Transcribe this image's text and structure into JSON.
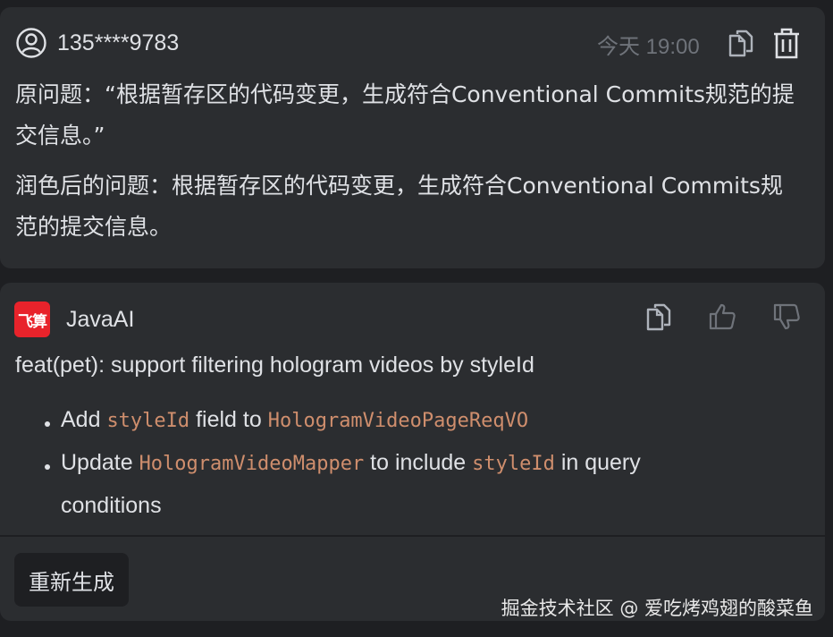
{
  "user_message": {
    "user": "135****9783",
    "timestamp": "今天 19:00",
    "icons": {
      "avatar": "user-circle-icon",
      "copy": "copy-icon",
      "delete": "trash-icon"
    },
    "original_question": "原问题：“根据暂存区的代码变更，生成符合Conventional Commits规范的提交信息。”",
    "polished_question": "润色后的问题：根据暂存区的代码变更，生成符合Conventional Commits规范的提交信息。"
  },
  "ai_message": {
    "logo_text": "飞算",
    "name": "JavaAI",
    "icons": {
      "copy": "copy-icon",
      "like": "thumbs-up-icon",
      "dislike": "thumbs-down-icon"
    },
    "commit_title": "feat(pet): support filtering hologram videos by styleId",
    "bullet1": {
      "pre": "Add ",
      "code1": "styleId",
      "mid": " field to ",
      "code2": "HologramVideoPageReqVO"
    },
    "bullet2": {
      "pre": "Update ",
      "code1": "HologramVideoMapper",
      "mid": " to include ",
      "code2": "styleId",
      "post": " in query conditions"
    },
    "regenerate_label": "重新生成"
  },
  "watermark": "掘金技术社区 @ 爱吃烤鸡翅的酸菜鱼",
  "colors": {
    "background": "#1e1f22",
    "card": "#2b2d30",
    "text": "#dfe1e5",
    "muted": "#6f737a",
    "code": "#cf8e6d",
    "brand": "#e8232b"
  }
}
